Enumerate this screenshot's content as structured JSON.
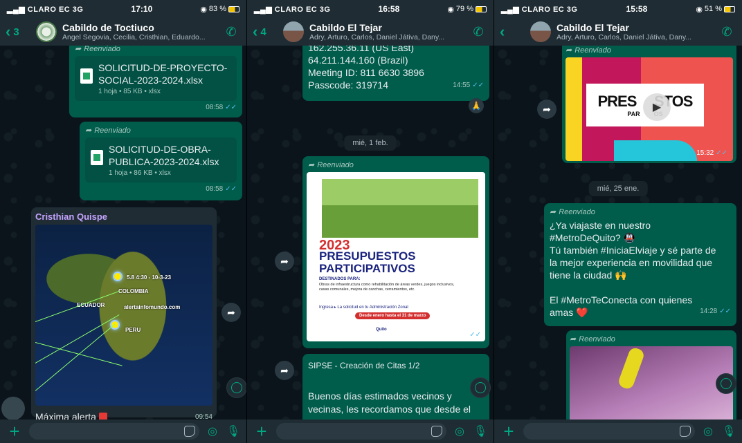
{
  "panels": [
    {
      "status": {
        "carrier": "CLARO EC",
        "network": "3G",
        "time": "17:10",
        "battery": "83 %"
      },
      "header": {
        "back_count": "3",
        "name": "Cabildo de Toctiuco",
        "members": "Angel Segovia, Cecilia, Cristhian, Eduardo..."
      },
      "messages": {
        "file1": {
          "forwarded": "",
          "name": "SOLICITUD-DE-PROYECTO-SOCIAL-2023-2024.xlsx",
          "meta": "1 hoja • 85 KB • xlsx",
          "time": "08:58"
        },
        "file2": {
          "forwarded": "Reenviado",
          "name": "SOLICITUD-DE-OBRA-PUBLICA-2023-2024.xlsx",
          "meta": "1 hoja • 86 KB • xlsx",
          "time": "08:58"
        },
        "map": {
          "sender": "Cristhian Quispe",
          "labels": {
            "quake": "5.8 4:30 - 10-3-23",
            "colombia": "COLOMBIA",
            "ecuador": "ECUADOR",
            "peru": "PERU",
            "site": "alertainfomundo.com"
          },
          "caption": "Máxima alerta",
          "time": "09:54"
        }
      }
    },
    {
      "status": {
        "carrier": "CLARO EC",
        "network": "3G",
        "time": "16:58",
        "battery": "79 %"
      },
      "header": {
        "back_count": "4",
        "name": "Cabildo El Tejar",
        "members": "Adry, Arturo, Carlos, Daniel Játiva, Dany..."
      },
      "messages": {
        "zoom": {
          "lines": [
            "162.255.36.11 (US East)",
            "64.211.144.160 (Brazil)",
            "Meeting ID: 811 6630 3896",
            "Passcode: 319714"
          ],
          "time": "14:55",
          "reaction": "🙏"
        },
        "date": "mié, 1 feb.",
        "poster": {
          "forwarded": "Reenviado",
          "year": "2023",
          "title_1": "PRESUPUESTOS",
          "title_2": "PARTICIPATIVOS",
          "destinados": "DESTINADOS PARA:",
          "obras": "Obras de infraestructura como rehabilitación de áreas verdes, juegos inclusivos, casas comunales, mejora de canchas, cerramientos, etc.",
          "ingresa": "Ingresa ▸ La solicitud en tu Administración Zonal",
          "fechas": "Desde enero hasta el 31 de marzo",
          "logo": "Quito",
          "time": "11:44"
        },
        "sipse": {
          "title": "SIPSE - Creación de Citas 1/2",
          "body": "Buenos días estimados vecinos y vecinas, les recordamos que desde el"
        }
      }
    },
    {
      "status": {
        "carrier": "CLARO EC",
        "network": "3G",
        "time": "15:58",
        "battery": "51 %"
      },
      "header": {
        "back_count": "",
        "name": "Cabildo El Tejar",
        "members": "Adry, Arturo, Carlos, Daniel Játiva, Dany..."
      },
      "messages": {
        "video": {
          "forwarded": "Reenviado",
          "title": "PRES",
          "title_end": "STOS",
          "subtitle": "PAR",
          "subtitle_end": "OS",
          "time": "15:32"
        },
        "date": "mié, 25 ene.",
        "metro": {
          "forwarded": "Reenviado",
          "lines": [
            "¿Ya viajaste en nuestro",
            "#MetroDeQuito? 🚇",
            "Tú también #IniciaElviaje y sé parte de",
            "la mejor experiencia en movilidad que",
            "tiene la ciudad 🙌",
            "",
            "El #MetroTeConecta con quienes",
            "amas ❤️"
          ],
          "time": "14:28"
        },
        "image": {
          "forwarded": "Reenviado"
        }
      }
    }
  ],
  "colors": {
    "outgoing": "#005c4b",
    "incoming": "#1f2c33",
    "accent": "#00a884",
    "read_tick": "#53bdeb"
  }
}
